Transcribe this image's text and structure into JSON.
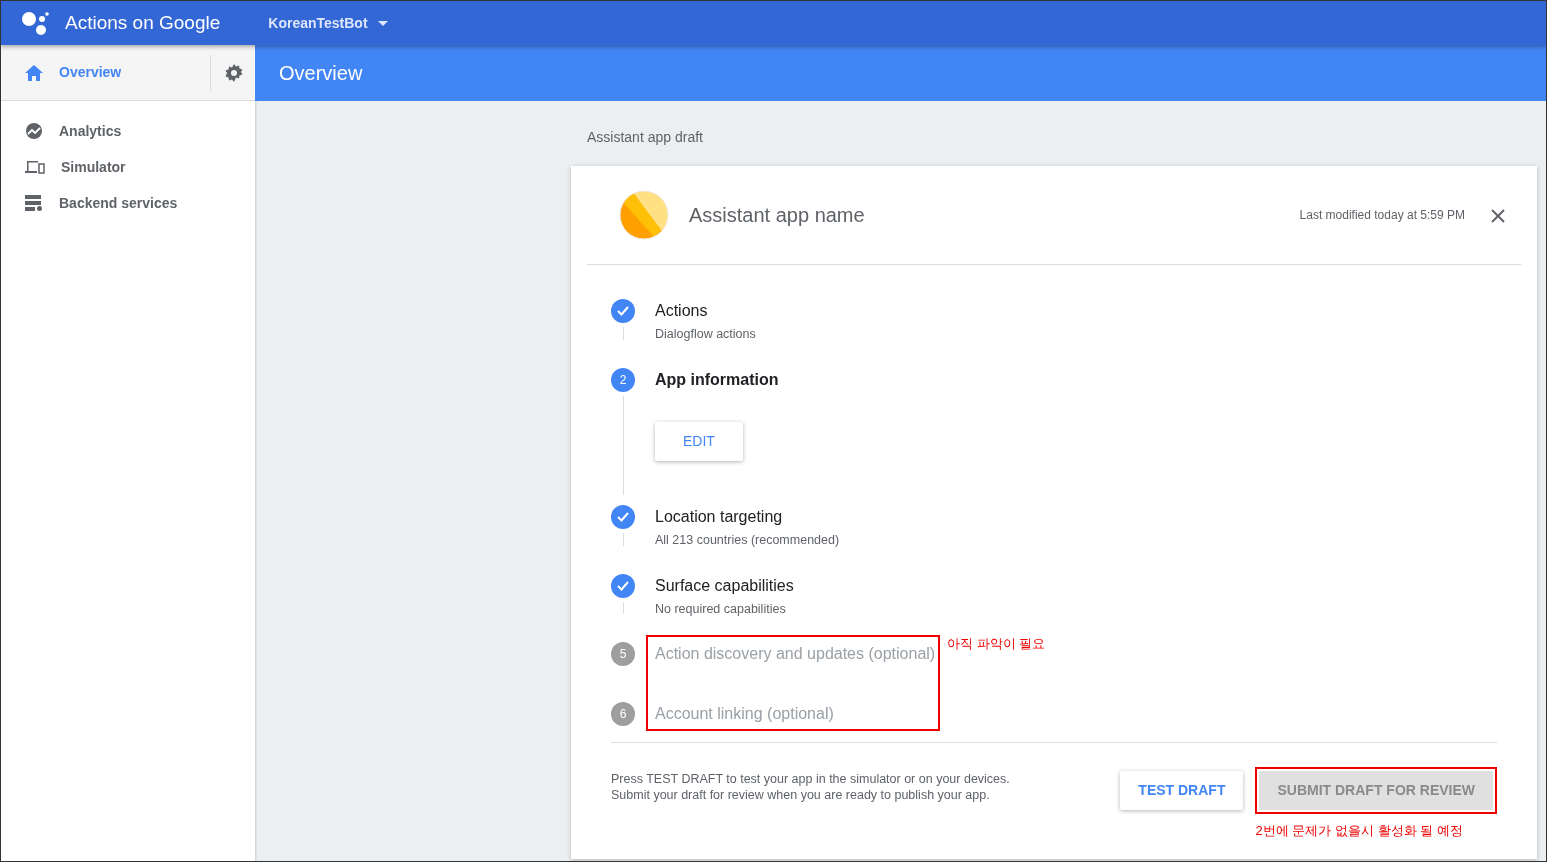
{
  "topbar": {
    "title": "Actions on Google",
    "project": "KoreanTestBot"
  },
  "sidebar": {
    "items": [
      {
        "label": "Overview",
        "selected": true
      },
      {
        "label": "Analytics",
        "selected": false
      },
      {
        "label": "Simulator",
        "selected": false
      },
      {
        "label": "Backend services",
        "selected": false
      }
    ]
  },
  "header": {
    "title": "Overview"
  },
  "draft_label": "Assistant app draft",
  "card": {
    "app_name": "Assistant app name",
    "last_modified": "Last modified today at 5:59 PM",
    "steps": [
      {
        "title": "Actions",
        "subtitle": "Dialogflow actions",
        "kind": "done",
        "highlighted": false
      },
      {
        "title": "App information",
        "number": "2",
        "kind": "current",
        "button": "EDIT",
        "highlighted": false
      },
      {
        "title": "Location targeting",
        "subtitle": "All 213 countries (recommended)",
        "kind": "done",
        "highlighted": false
      },
      {
        "title": "Surface capabilities",
        "subtitle": "No required capabilities",
        "kind": "done",
        "highlighted": false
      },
      {
        "title": "Action discovery and updates (optional)",
        "number": "5",
        "kind": "disabled",
        "highlighted": true
      },
      {
        "title": "Account linking (optional)",
        "number": "6",
        "kind": "disabled",
        "highlighted": true
      }
    ],
    "steps_note": "아직 파악이 필요",
    "footer_text": [
      "Press TEST DRAFT to test your app in the simulator or on your devices.",
      "Submit your draft for review when you are ready to publish your app."
    ],
    "buttons": [
      {
        "label": "TEST DRAFT",
        "disabled": false,
        "highlighted": false
      },
      {
        "label": "SUBMIT DRAFT FOR REVIEW",
        "disabled": true,
        "highlighted": true,
        "note": "2번에 문제가 없을시 활성화 될 예정"
      }
    ]
  }
}
